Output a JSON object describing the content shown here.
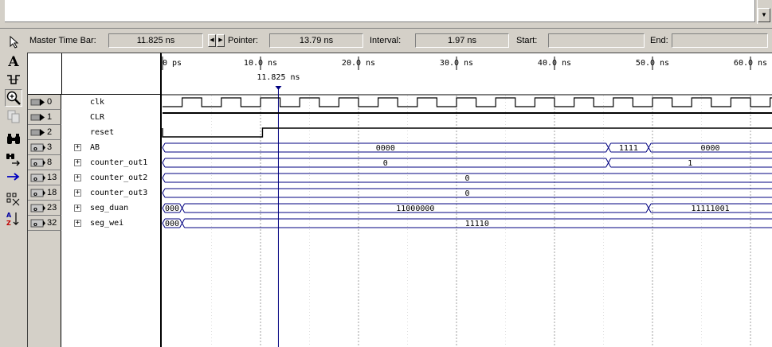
{
  "top": {
    "scroll_down_icon": "triangle-down"
  },
  "timebar": {
    "master_label": "Master Time Bar:",
    "master_value": "11.825 ns",
    "pointer_label": "Pointer:",
    "pointer_value": "13.79 ns",
    "interval_label": "Interval:",
    "interval_value": "1.97 ns",
    "start_label": "Start:",
    "start_value": "",
    "end_label": "End:",
    "end_value": ""
  },
  "toolbar": {
    "icons": [
      "selection-arrow-icon",
      "text-tool-icon",
      "waveform-editing-icon",
      "zoom-icon",
      "copy-icon",
      "find-icon",
      "find-next-icon",
      "goto-icon",
      "group-icon",
      "sort-icon"
    ]
  },
  "timescale": {
    "ticks": [
      "0 ps",
      "10.0 ns",
      "20.0 ns",
      "30.0 ns",
      "40.0 ns",
      "50.0 ns",
      "60.0 ns"
    ],
    "tick_ns": [
      0,
      10,
      20,
      30,
      40,
      50,
      60
    ],
    "master_marker_label": "11.825 ns",
    "master_ns": 11.825,
    "pointer_ns": 13.79
  },
  "signals": [
    {
      "index": "0",
      "name": "clk",
      "type": "input",
      "bus": false
    },
    {
      "index": "1",
      "name": "CLR",
      "type": "input",
      "bus": false
    },
    {
      "index": "2",
      "name": "reset",
      "type": "input",
      "bus": false
    },
    {
      "index": "3",
      "name": "AB",
      "type": "output",
      "bus": true,
      "expand": "+"
    },
    {
      "index": "8",
      "name": "counter_out1",
      "type": "output",
      "bus": true,
      "expand": "+"
    },
    {
      "index": "13",
      "name": "counter_out2",
      "type": "output",
      "bus": true,
      "expand": "+"
    },
    {
      "index": "18",
      "name": "counter_out3",
      "type": "output",
      "bus": true,
      "expand": "+"
    },
    {
      "index": "23",
      "name": "seg_duan",
      "type": "output",
      "bus": true,
      "expand": "+"
    },
    {
      "index": "32",
      "name": "seg_wei",
      "type": "output",
      "bus": true,
      "expand": "+"
    }
  ],
  "waves": {
    "clk_period_ns": 4.0,
    "clk_first_rise_ns": 2.0,
    "clr_level": 1,
    "reset_rise_ns": 10.2,
    "buses": [
      {
        "name": "AB",
        "segments": [
          {
            "from": 0,
            "to": 45.5,
            "value": "0000"
          },
          {
            "from": 45.5,
            "to": 49.6,
            "value": "1111"
          },
          {
            "from": 49.6,
            "to": 62.5,
            "value": "0000"
          }
        ]
      },
      {
        "name": "counter_out1",
        "segments": [
          {
            "from": 0,
            "to": 45.5,
            "value": "0"
          },
          {
            "from": 45.5,
            "to": 62.5,
            "value": "1"
          }
        ]
      },
      {
        "name": "counter_out2",
        "segments": [
          {
            "from": 0,
            "to": 62.5,
            "value": "0"
          }
        ]
      },
      {
        "name": "counter_out3",
        "segments": [
          {
            "from": 0,
            "to": 62.5,
            "value": "0"
          }
        ]
      },
      {
        "name": "seg_duan",
        "segments": [
          {
            "from": 0,
            "to": 2.0,
            "value": "000"
          },
          {
            "from": 2.0,
            "to": 49.6,
            "value": "11000000"
          },
          {
            "from": 49.6,
            "to": 62.5,
            "value": "11111001"
          }
        ]
      },
      {
        "name": "seg_wei",
        "segments": [
          {
            "from": 0,
            "to": 2.0,
            "value": "000"
          },
          {
            "from": 2.0,
            "to": 62.5,
            "value": "11110"
          }
        ]
      }
    ]
  },
  "colors": {
    "wave": "#000000",
    "bus": "#000080",
    "master_line": "#000080",
    "grid": "#a0a0a0",
    "background": "#ffffff"
  }
}
